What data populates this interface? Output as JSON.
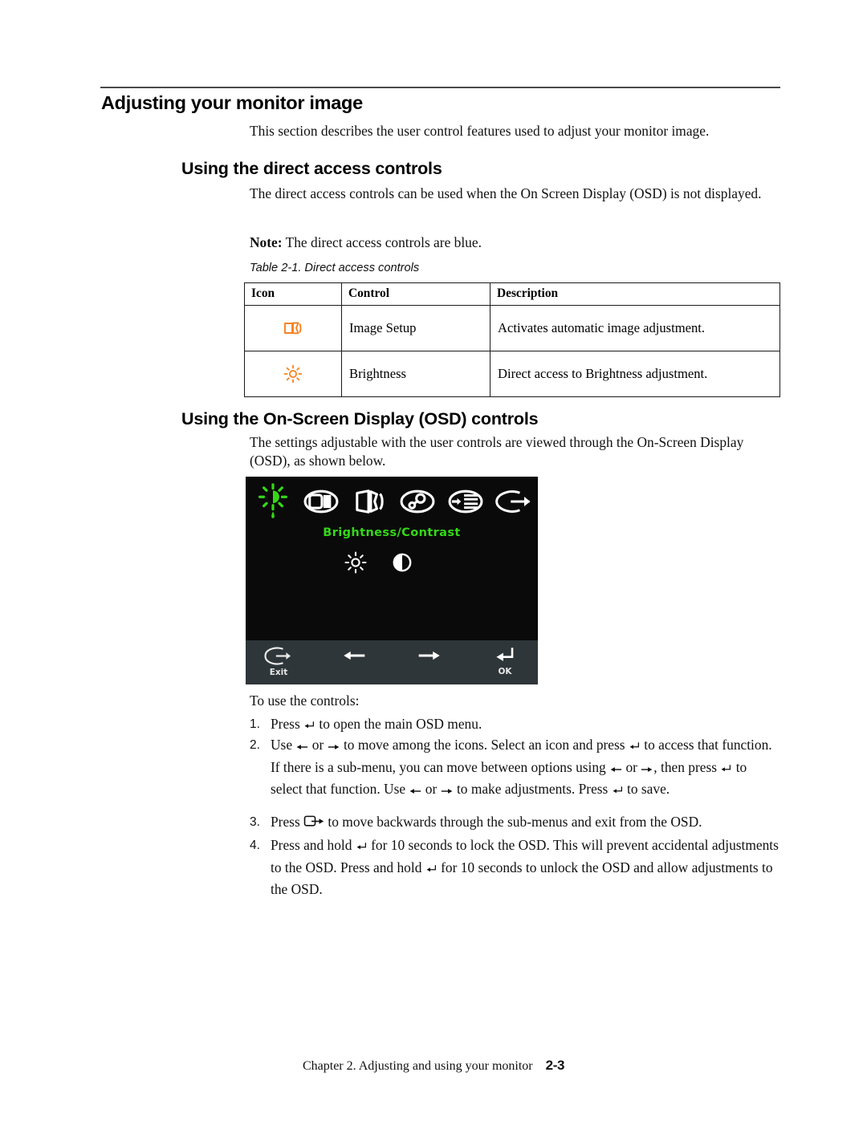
{
  "page": {
    "heading": "Adjusting your monitor image",
    "intro": "This section describes the user control features used to adjust your monitor image."
  },
  "direct_access": {
    "heading": "Using the direct access controls",
    "paragraph": "The direct access controls can be used when the On Screen Display (OSD) is not displayed.",
    "note_label": "Note:",
    "note_text": "The direct access controls are blue.",
    "table_caption": "Table 2-1. Direct access controls",
    "table": {
      "headers": [
        "Icon",
        "Control",
        "Description"
      ],
      "rows": [
        {
          "icon": "image-setup-icon",
          "control": "Image Setup",
          "description": "Activates automatic image adjustment."
        },
        {
          "icon": "brightness-icon",
          "control": "Brightness",
          "description": "Direct access to Brightness adjustment."
        }
      ]
    },
    "icon_color": "#F58220"
  },
  "osd_section": {
    "heading": "Using the On-Screen Display (OSD) controls",
    "paragraph": "The settings adjustable with the user controls are viewed through the On-Screen Display (OSD), as shown below.",
    "screenshot": {
      "background": "#0a0a0a",
      "footer_background": "#2e3639",
      "highlight_color": "#35d818",
      "icon_color": "#ffffff",
      "title": "Brightness/Contrast",
      "top_icons": [
        "brightness-contrast-icon",
        "image-position-icon",
        "image-setup-icon",
        "image-properties-icon",
        "options-icon",
        "exit-icon"
      ],
      "sub_icons": [
        "brightness-icon",
        "contrast-icon"
      ],
      "footer_items": [
        {
          "icon": "exit-icon",
          "label": "Exit"
        },
        {
          "icon": "left-arrow-icon",
          "label": ""
        },
        {
          "icon": "right-arrow-icon",
          "label": ""
        },
        {
          "icon": "enter-icon",
          "label": "OK"
        }
      ]
    },
    "to_use": "To use the controls:",
    "steps": [
      {
        "num": "1.",
        "parts": [
          {
            "t": "text",
            "v": "Press "
          },
          {
            "t": "glyph",
            "v": "enter-icon"
          },
          {
            "t": "text",
            "v": " to open the main OSD menu."
          }
        ]
      },
      {
        "num": "2.",
        "parts": [
          {
            "t": "text",
            "v": "Use "
          },
          {
            "t": "glyph",
            "v": "left-arrow-icon"
          },
          {
            "t": "text",
            "v": " or "
          },
          {
            "t": "glyph",
            "v": "right-arrow-icon"
          },
          {
            "t": "text",
            "v": " to move among the icons. Select an icon and press "
          },
          {
            "t": "glyph",
            "v": "enter-icon"
          },
          {
            "t": "text",
            "v": " to access that function. If there is a sub-menu, you can move between options using "
          },
          {
            "t": "glyph",
            "v": "left-arrow-icon"
          },
          {
            "t": "text",
            "v": " or "
          },
          {
            "t": "glyph",
            "v": "right-arrow-icon"
          },
          {
            "t": "text",
            "v": ", then press "
          },
          {
            "t": "glyph",
            "v": "enter-icon"
          },
          {
            "t": "text",
            "v": " to select that function. Use "
          },
          {
            "t": "glyph",
            "v": "left-arrow-icon"
          },
          {
            "t": "text",
            "v": " or "
          },
          {
            "t": "glyph",
            "v": "right-arrow-icon"
          },
          {
            "t": "text",
            "v": " to make adjustments. Press "
          },
          {
            "t": "glyph",
            "v": "enter-icon"
          },
          {
            "t": "text",
            "v": " to save."
          }
        ]
      },
      {
        "num": "3.",
        "parts": [
          {
            "t": "text",
            "v": "Press "
          },
          {
            "t": "glyph",
            "v": "exit-icon"
          },
          {
            "t": "text",
            "v": " to move backwards through the sub-menus and exit from the OSD."
          }
        ]
      },
      {
        "num": "4.",
        "parts": [
          {
            "t": "text",
            "v": "Press and hold "
          },
          {
            "t": "glyph",
            "v": "enter-icon"
          },
          {
            "t": "text",
            "v": " for 10 seconds to lock the OSD. This will prevent accidental adjustments to the OSD. Press and hold "
          },
          {
            "t": "glyph",
            "v": "enter-icon"
          },
          {
            "t": "text",
            "v": " for 10 seconds to unlock the OSD and allow adjustments to the OSD."
          }
        ]
      }
    ]
  },
  "footer": {
    "text": "Chapter 2. Adjusting and using your monitor",
    "page_number": "2-3"
  }
}
